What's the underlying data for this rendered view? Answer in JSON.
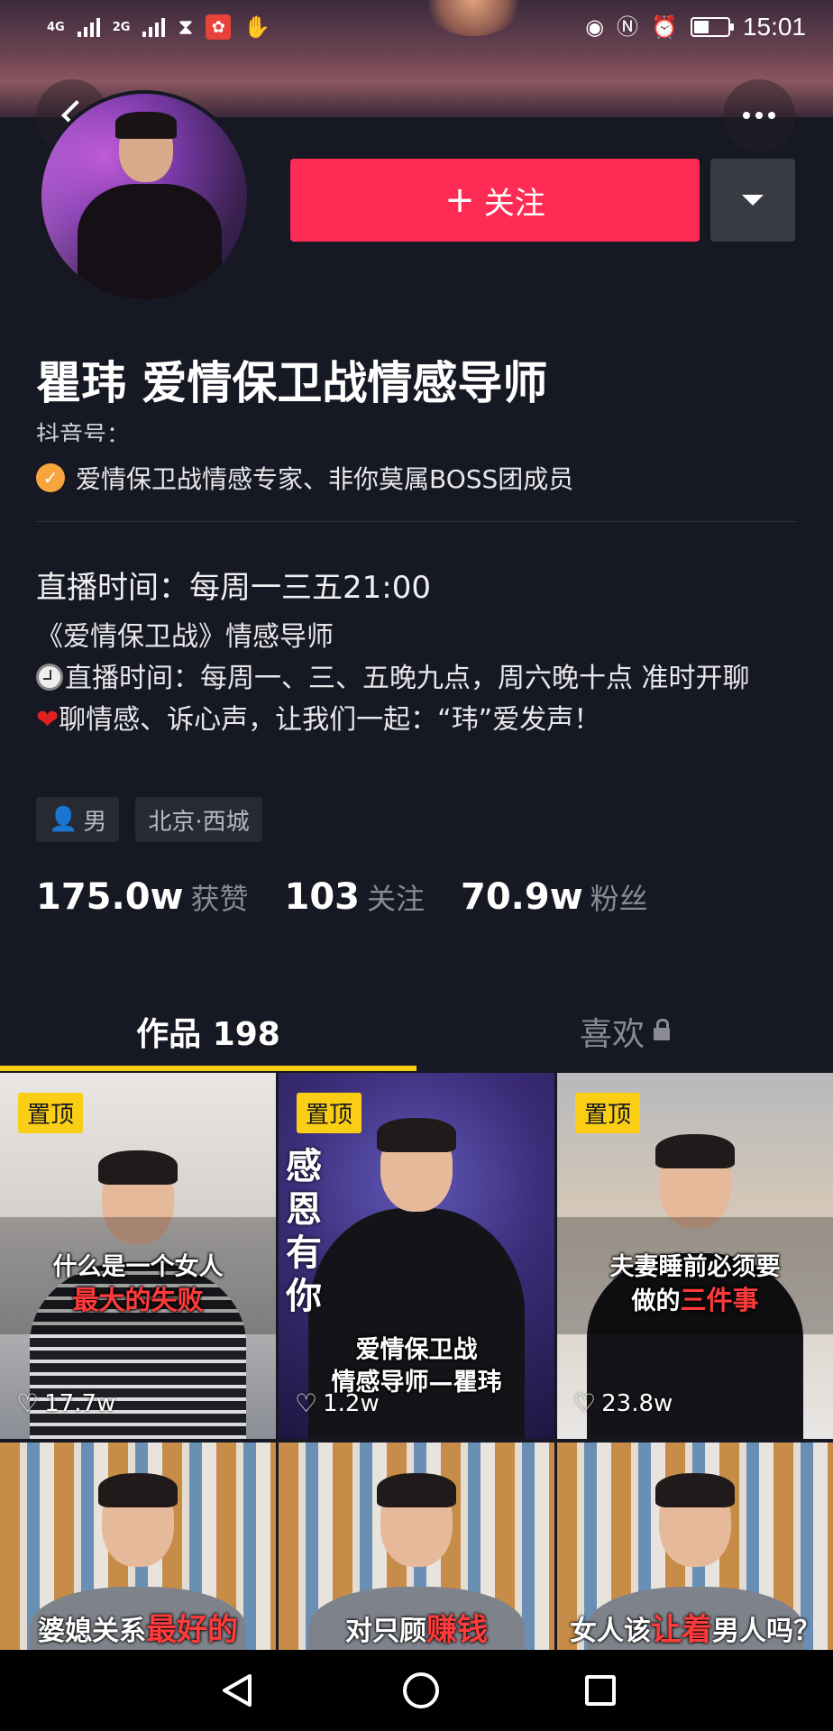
{
  "status_bar": {
    "network1": "4G",
    "network2": "2G",
    "time": "15:01"
  },
  "profile": {
    "name": "瞿玮 爱情保卫战情感导师",
    "douyin_id": "抖音号：",
    "verified_text": "爱情保卫战情感专家、非你莫属BOSS团成员",
    "follow_label": "关注",
    "live_time": "直播时间：每周一三五21:00",
    "bio_line1": "《爱情保卫战》情感导师",
    "bio_line2": "直播时间：每周一、三、五晚九点，周六晚十点 准时开聊",
    "bio_line3": "聊情感、诉心声，让我们一起：“玮”爱发声！",
    "tags": {
      "gender": "男",
      "location": "北京·西城"
    },
    "stats": {
      "likes_num": "175.0w",
      "likes_label": "获赞",
      "following_num": "103",
      "following_label": "关注",
      "fans_num": "70.9w",
      "fans_label": "粉丝"
    }
  },
  "tabs": {
    "works": "作品 198",
    "likes": "喜欢"
  },
  "videos": [
    {
      "pin": "置顶",
      "caption_line1": "什么是一个女人",
      "caption_hl": "最大的失败",
      "likes": "17.7w"
    },
    {
      "pin": "置顶",
      "vertical_caption": "感恩有你",
      "caption_line1": "爱情保卫战",
      "caption_line2": "情感导师—瞿玮",
      "likes": "1.2w"
    },
    {
      "pin": "置顶",
      "caption_line1": "夫妻睡前必须要",
      "caption_pre": "做的",
      "caption_hl": "三件事",
      "likes": "23.8w"
    },
    {
      "caption_pre": "婆媳关系",
      "caption_hl": "最好的"
    },
    {
      "caption_pre": "对只顾",
      "caption_hl": "赚钱"
    },
    {
      "caption_pre": "女人该",
      "caption_hl": "让着",
      "caption_post": "男人吗？"
    }
  ],
  "colors": {
    "background": "#161823",
    "follow_button": "#fe2c55",
    "tab_underline": "#face15",
    "pin_badge": "#face15",
    "verify_badge": "#f7a53d"
  }
}
